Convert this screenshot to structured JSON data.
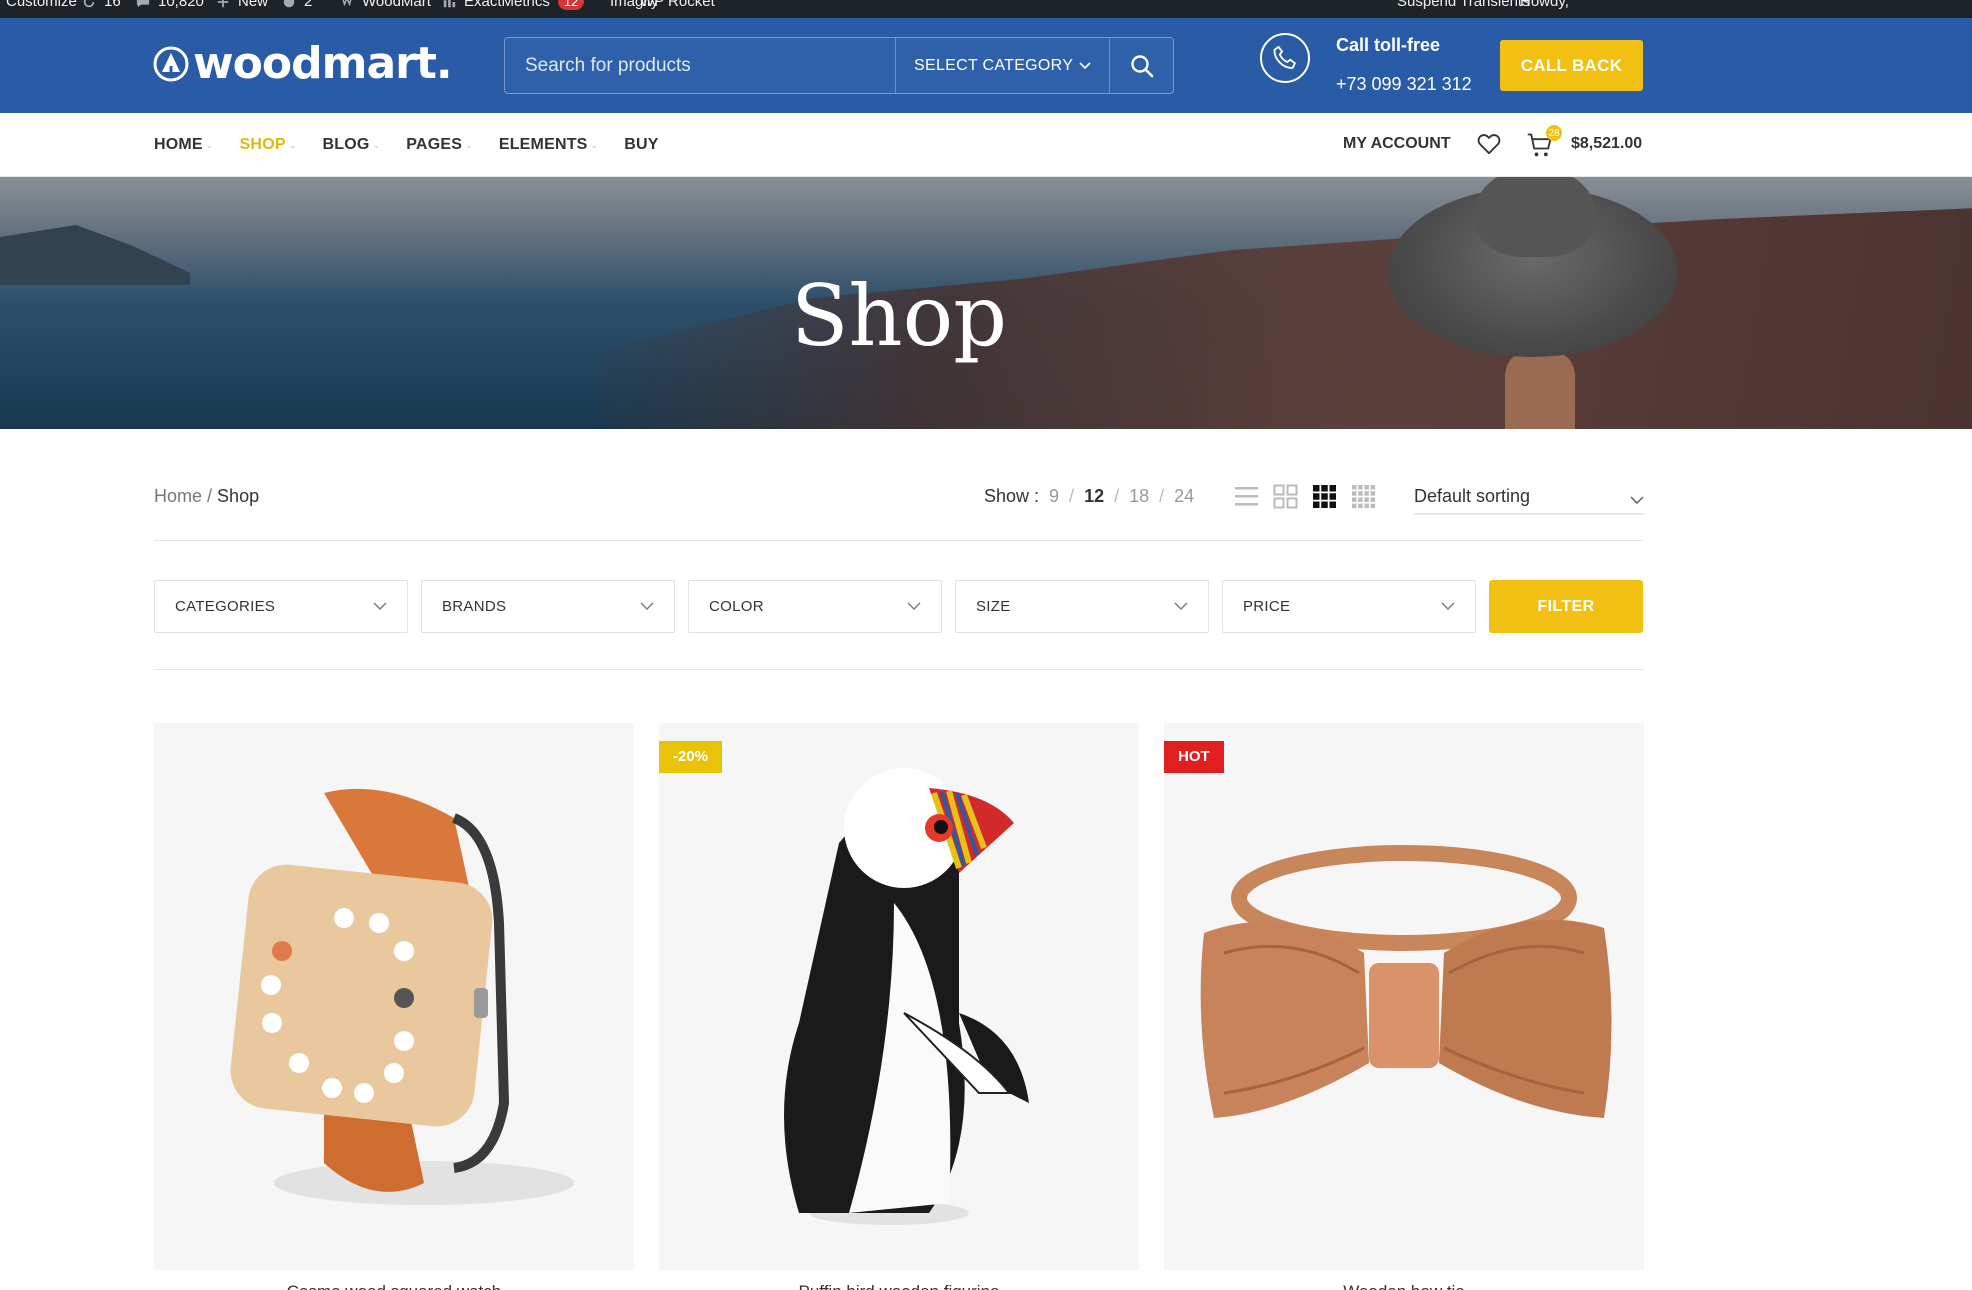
{
  "adminbar": {
    "items": [
      {
        "label": "Customize"
      },
      {
        "label": "16"
      },
      {
        "label": "10,820"
      },
      {
        "label": "New"
      },
      {
        "label": "2"
      },
      {
        "label": "WoodMart"
      },
      {
        "label": "ExactMetrics",
        "badge": "12"
      },
      {
        "label": "Imagify"
      },
      {
        "label": "WP Rocket"
      }
    ],
    "right": [
      "Suspend Transients",
      "Howdy,"
    ]
  },
  "header": {
    "logo_text": "woodmart.",
    "search_placeholder": "Search for products",
    "select_category": "SELECT CATEGORY",
    "call_title": "Call toll-free",
    "call_number": "+73 099 321 312",
    "call_back": "CALL BACK",
    "colors": {
      "brand_blue": "#2a5ba6",
      "accent_yellow": "#f2c012"
    }
  },
  "nav": {
    "items": [
      {
        "label": "HOME"
      },
      {
        "label": "SHOP"
      },
      {
        "label": "BLOG"
      },
      {
        "label": "PAGES"
      },
      {
        "label": "ELEMENTS"
      },
      {
        "label": "BUY"
      }
    ],
    "active": "SHOP",
    "account": "MY ACCOUNT",
    "cart_count": "28",
    "cart_total": "$8,521.00"
  },
  "hero": {
    "title": "Shop"
  },
  "toolbar": {
    "breadcrumb": [
      "Home",
      "Shop"
    ],
    "show_label": "Show :",
    "show_options": [
      "9",
      "12",
      "18",
      "24"
    ],
    "show_selected": "12",
    "sort": "Default sorting"
  },
  "filters": {
    "selects": [
      "CATEGORIES",
      "BRANDS",
      "COLOR",
      "SIZE",
      "PRICE"
    ],
    "button": "FILTER"
  },
  "products": [
    {
      "name": "Cosmo wood squared watch",
      "badge": ""
    },
    {
      "name": "Puffin bird wooden figurine",
      "badge": "-20%"
    },
    {
      "name": "Wooden bow tie",
      "badge": "HOT"
    }
  ]
}
